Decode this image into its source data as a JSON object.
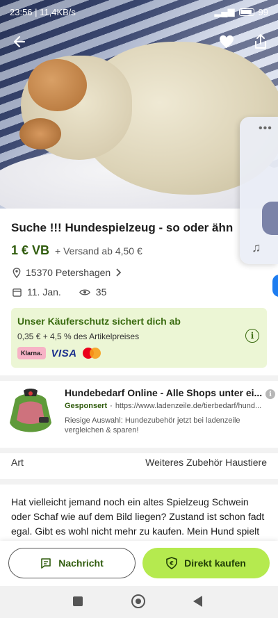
{
  "status_bar": {
    "time_net": "23:56 | 11,4KB/s",
    "battery": "99"
  },
  "listing": {
    "title": "Suche !!!  Hundespielzeug - so oder ähn",
    "price": "1 € VB",
    "shipping": "+ Versand ab 4,50 €",
    "location": "15370 Petershagen",
    "date": "11. Jan.",
    "views": "35"
  },
  "buyer_protection": {
    "title": "Unser Käuferschutz sichert dich ab",
    "fee": "0,35 € + 4,5 % des Artikelpreises",
    "payment_logos": [
      "Klarna.",
      "VISA"
    ]
  },
  "ad": {
    "title": "Hundebedarf Online - Alle Shops unter ei...",
    "sponsored": "Gesponsert",
    "url": "https://www.ladenzeile.de/tierbedarf/hund...",
    "description": "Riesige Auswahl: Hundezubehör jetzt bei ladenzeile vergleichen & sparen!"
  },
  "attribute": {
    "label": "Art",
    "value": "Weiteres Zubehör Haustiere"
  },
  "description": "Hat vielleicht jemand noch ein altes Spielzeug Schwein oder Schaf wie auf dem Bild liegen? Zustand ist schon fadt egal. Gibt es wohl nicht mehr zu kaufen. Mein Hund spielt leider",
  "actions": {
    "message": "Nachricht",
    "buy": "Direkt kaufen"
  },
  "colors": {
    "brand_green": "#2f5b0c",
    "accent_lime": "#b5ea4f",
    "protection_bg": "#ecf6d5"
  }
}
